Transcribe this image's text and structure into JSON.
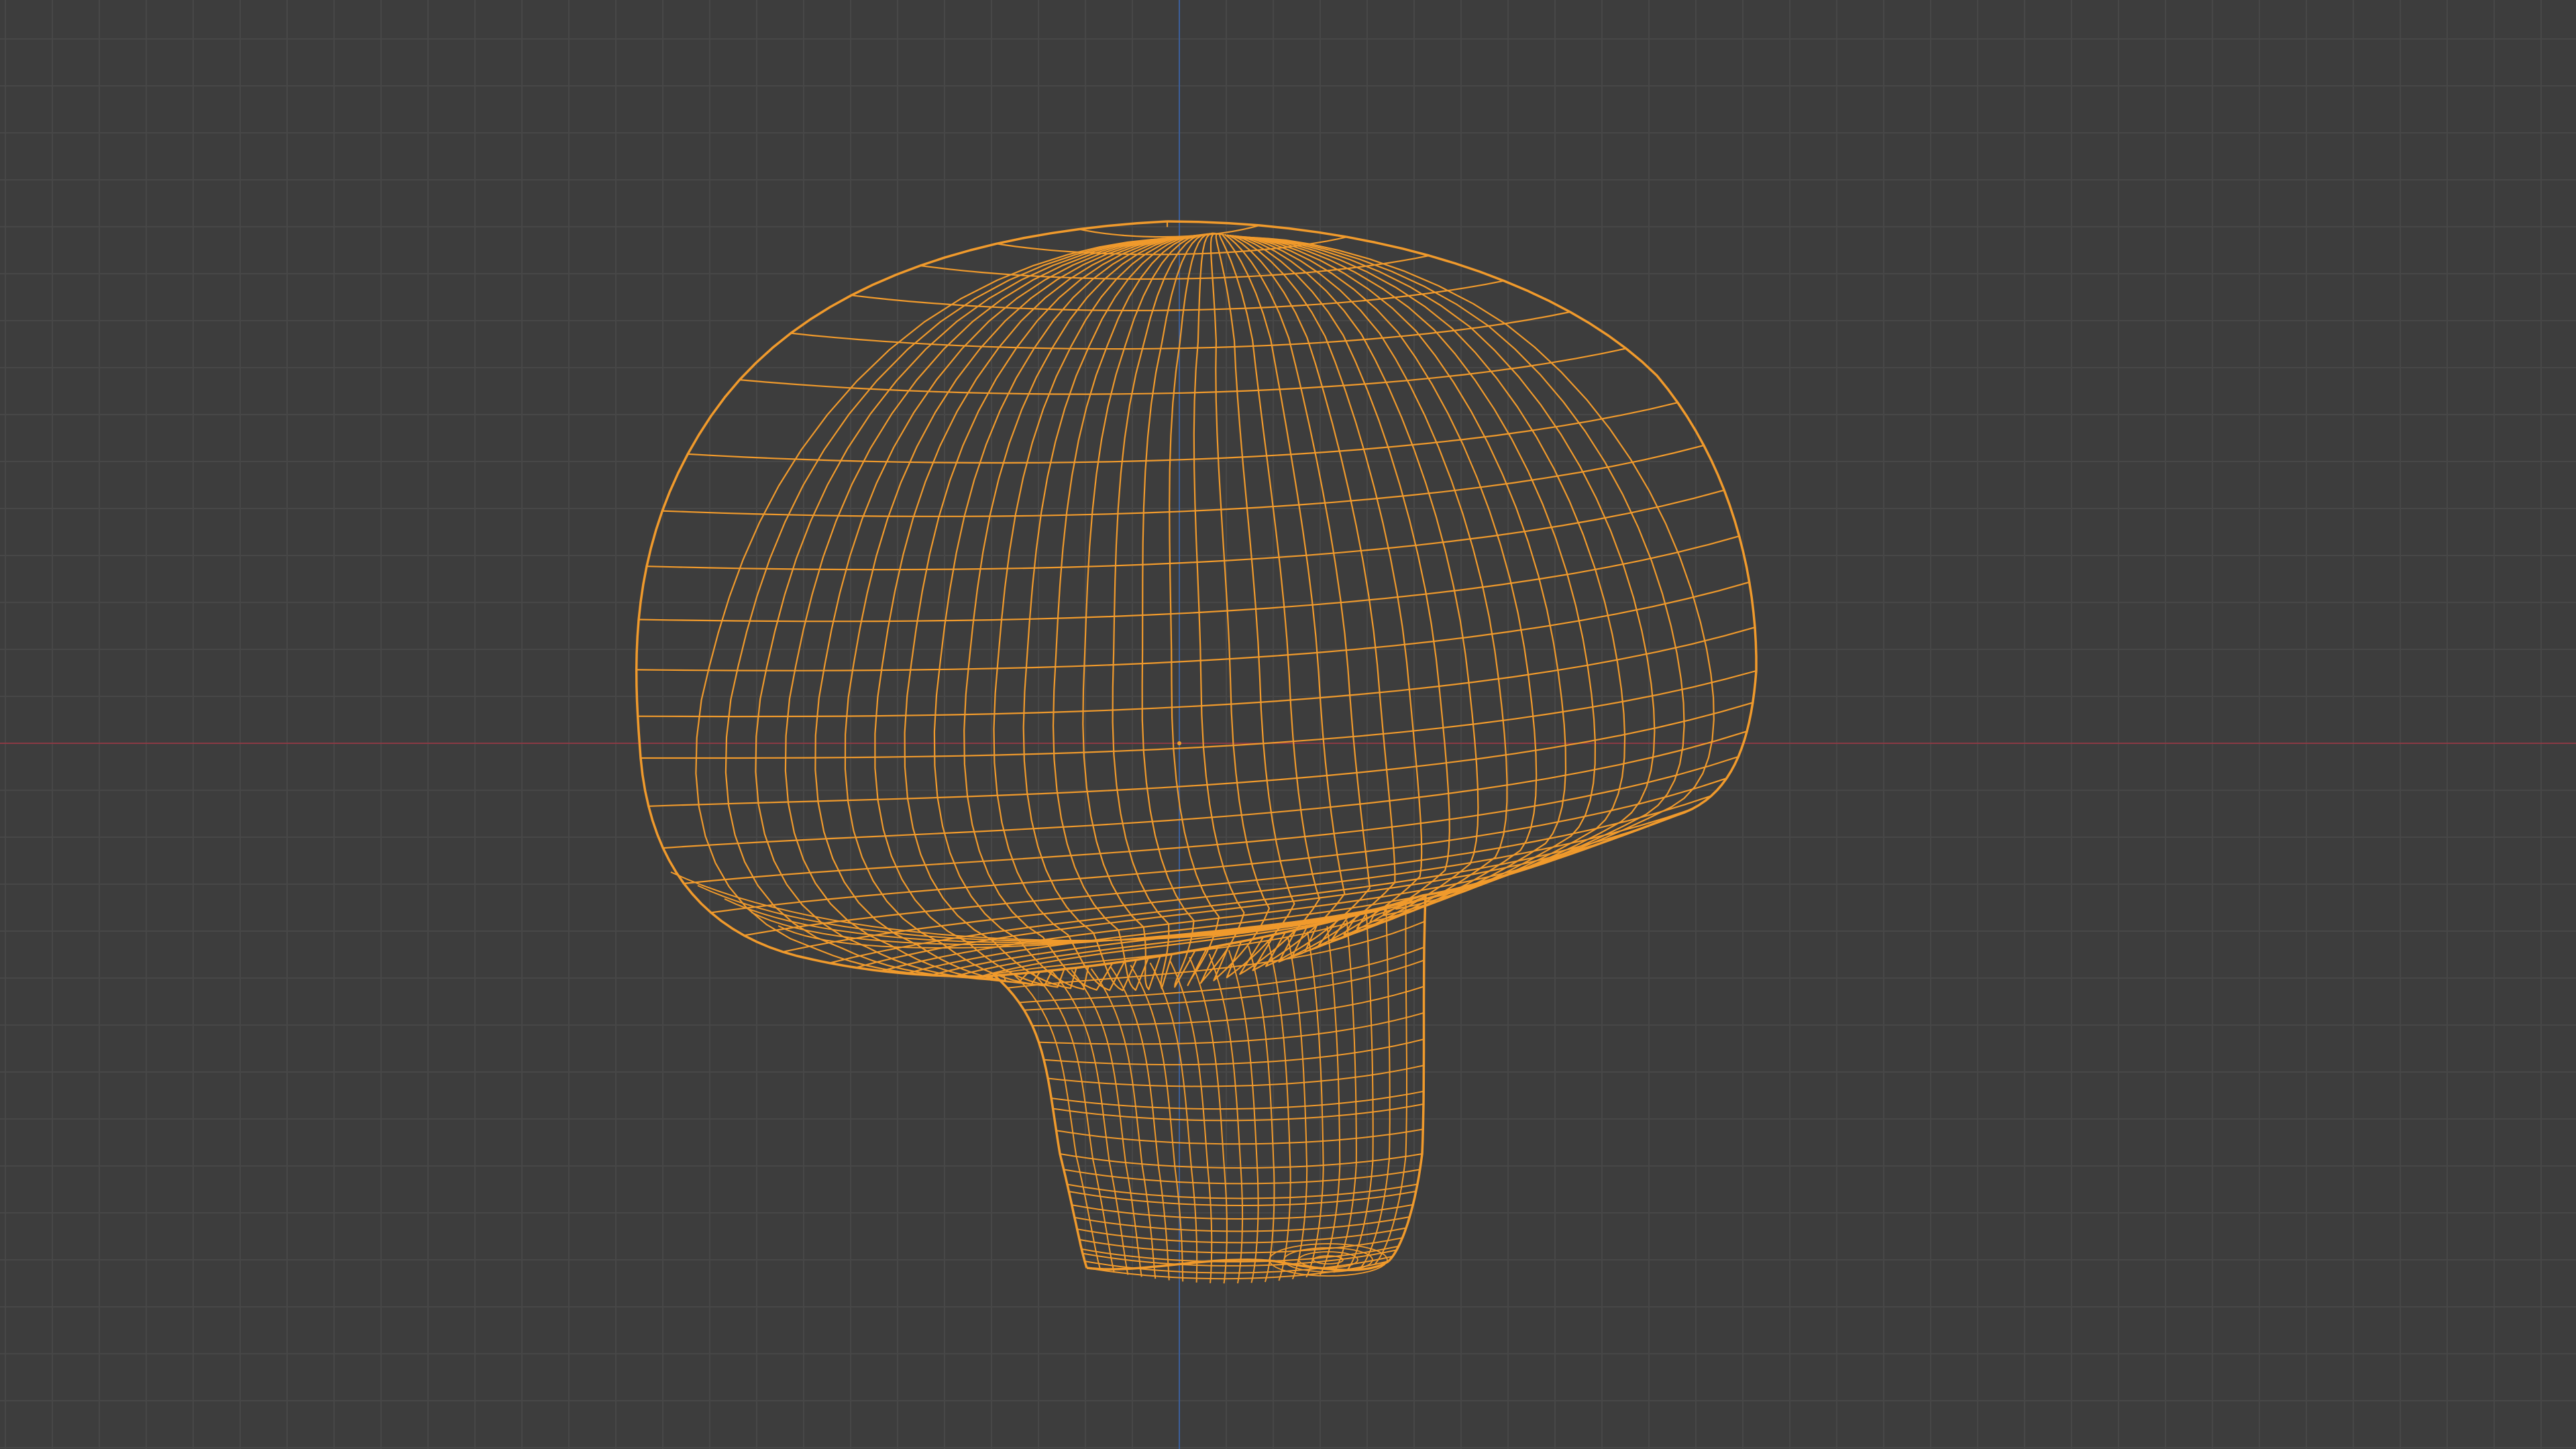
{
  "viewport": {
    "mode": "wireframe",
    "background_color": "#3d3d3d",
    "grid_color": "#474747",
    "x_axis_color": "#8a3a44",
    "y_axis_color": "#3c5f9a",
    "wire_color": "#f09a2c",
    "selected_object": "mushroom",
    "object_origin_icon": "origin-dot-icon"
  }
}
